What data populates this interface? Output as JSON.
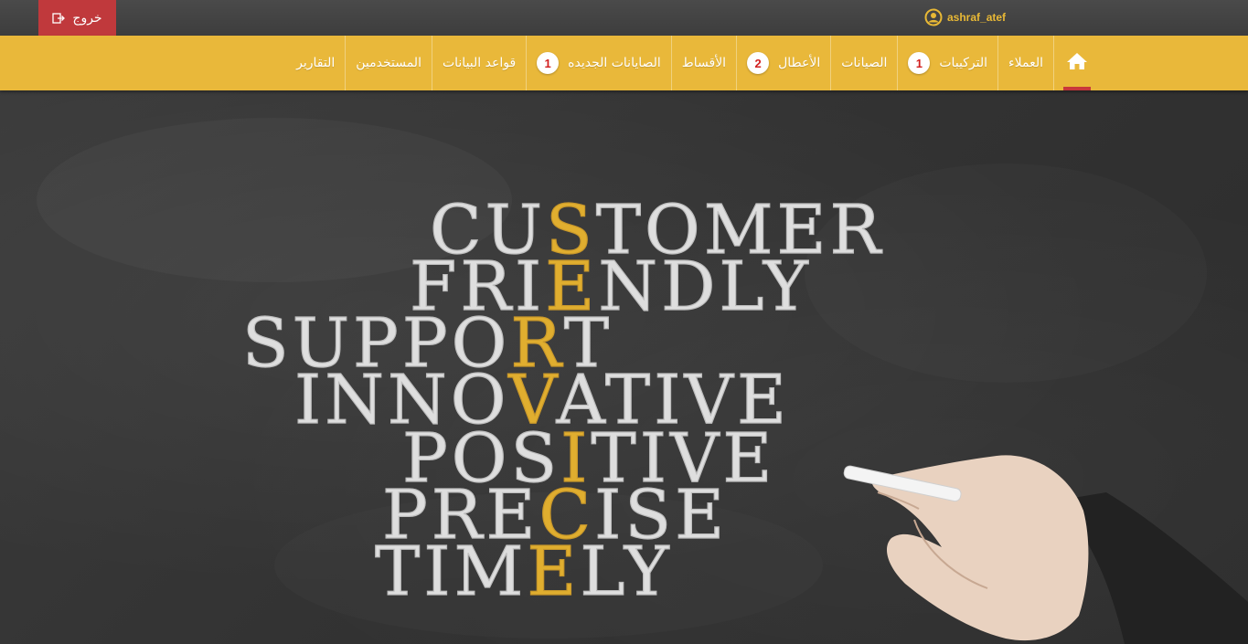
{
  "header": {
    "logout_label": "خروج",
    "username": "ashraf_atef"
  },
  "nav": {
    "items": [
      {
        "label": "العملاء"
      },
      {
        "label": "التركيبات",
        "badge": "1"
      },
      {
        "label": "الصيانات"
      },
      {
        "label": "الأعطال",
        "badge": "2"
      },
      {
        "label": "الأقساط"
      },
      {
        "label": "الصايانات الجديده",
        "badge": "1"
      },
      {
        "label": "قواعد البيانات"
      },
      {
        "label": "المستخدمين"
      },
      {
        "label": "التقارير"
      }
    ]
  },
  "hero": {
    "words": [
      "CUSTOMER",
      "FRIENDLY",
      "SUPPORT",
      "INNOVATIVE",
      "POSITIVE",
      "PRECISE",
      "TIMELY"
    ],
    "highlight": "SERVICE"
  },
  "colors": {
    "topbar": "#404040",
    "navbar": "#e9b83a",
    "logout": "#c0393c",
    "badge_text": "#d21f1f",
    "active_indicator": "#c8373b",
    "chalk_highlight": "#e0ae2f"
  }
}
